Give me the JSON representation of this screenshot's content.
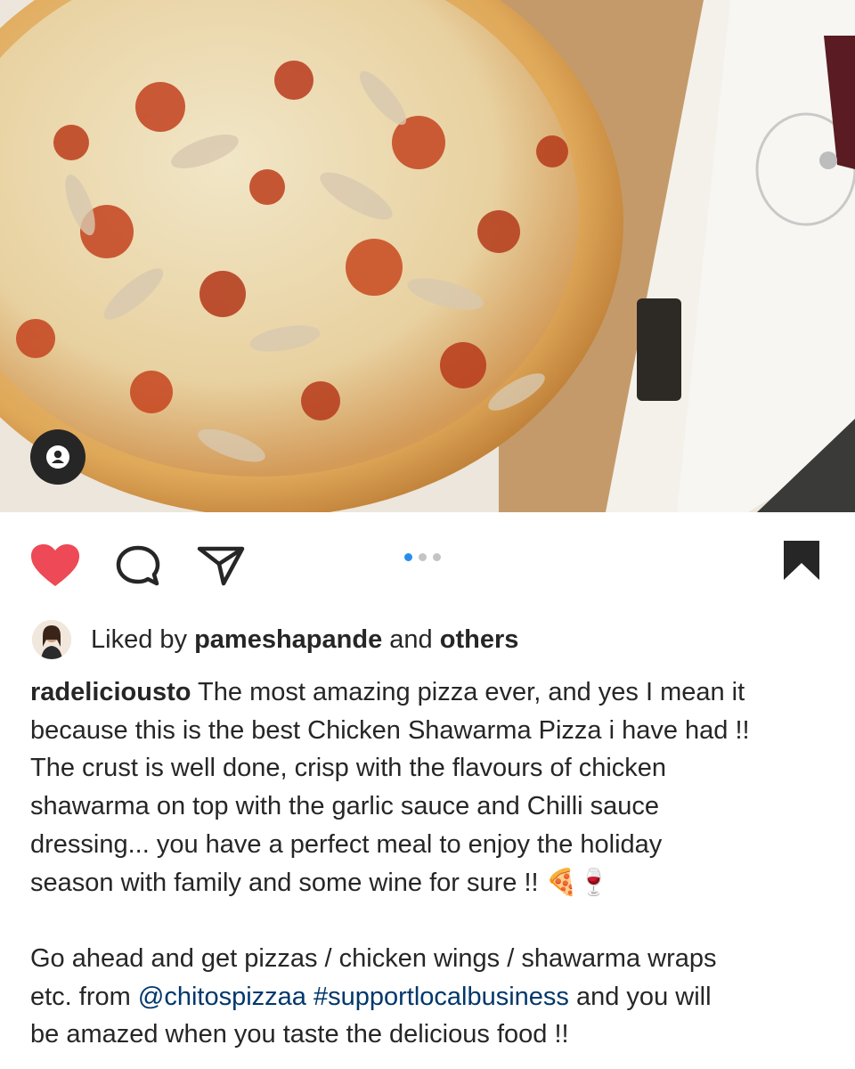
{
  "post": {
    "image_alt": "Chicken shawarma pizza in a cardboard box with a glass of red wine",
    "carousel": {
      "count": 3,
      "active": 0
    },
    "liked_by": {
      "prefix": "Liked by",
      "user": "pameshapande",
      "middle": "and",
      "others": "others"
    },
    "caption": {
      "username": "radeliciousto",
      "line1": "The most amazing pizza ever, and yes I mean it",
      "line2": "because this is the best Chicken Shawarma Pizza i have had !!",
      "line3": "The crust is well done, crisp with the flavours of chicken",
      "line4": "shawarma on top with the garlic sauce and Chilli sauce",
      "line5": "dressing... you have a perfect meal to enjoy the holiday",
      "line6": "season with family and some wine for sure !! 🍕🍷",
      "para2_line1": "Go ahead and get pizzas / chicken wings / shawarma wraps",
      "para2_line2_prefix": "etc. from",
      "mention": "@chitospizzaa",
      "hashtag": "#supportlocalbusiness",
      "para2_line2_suffix": " and you will",
      "para2_line3": "be amazed when you taste the delicious food !!"
    }
  },
  "icons": {
    "like": "heart-icon",
    "comment": "comment-icon",
    "share": "send-icon",
    "save": "bookmark-icon",
    "tag": "user-tag-icon"
  },
  "colors": {
    "like": "#ed4956",
    "link": "#00376b",
    "carousel_active": "#2a8ee9"
  }
}
